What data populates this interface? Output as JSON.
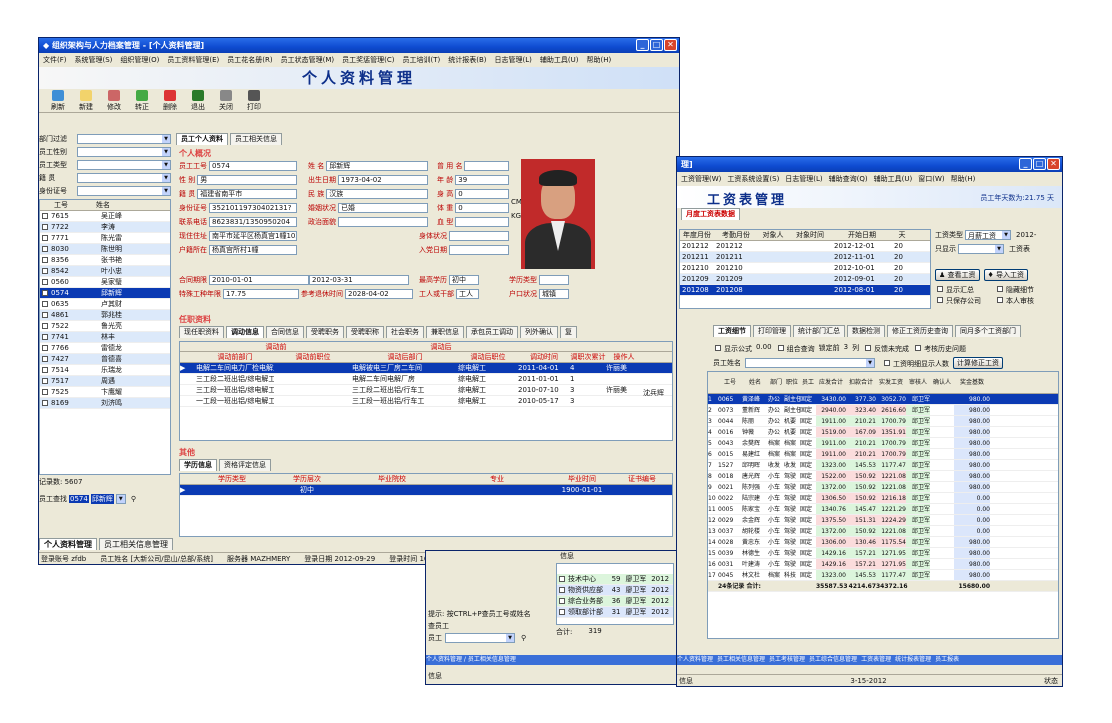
{
  "w1": {
    "title": "组织架构与人力档案管理 - [个人资料管理]",
    "menu": [
      "文件(F)",
      "系统管理(S)",
      "组织管理(O)",
      "员工资料管理(E)",
      "员工花名册(R)",
      "员工状态管理(M)",
      "员工奖惩管理(C)",
      "员工培训(T)",
      "统计报表(B)",
      "日志管理(L)",
      "辅助工具(U)",
      "帮助(H)"
    ],
    "heading": "个人资料管理",
    "toolbar": [
      "刷新",
      "新建",
      "修改",
      "转正",
      "删除",
      "退出",
      "关闭",
      "打印"
    ],
    "filters": [
      "部门过滤",
      "员工性别",
      "员工类型",
      "籍 贯",
      "身份证号"
    ],
    "list_headers": [
      "工号",
      "姓名"
    ],
    "employees": [
      [
        "7615",
        "吴正峰"
      ],
      [
        "7722",
        "李涛"
      ],
      [
        "7771",
        "陈光雷"
      ],
      [
        "8030",
        "陈世明"
      ],
      [
        "8356",
        "张书艳"
      ],
      [
        "8542",
        "叶小忠"
      ],
      [
        "0560",
        "吴家璧"
      ],
      [
        "0574",
        "邱新辉"
      ],
      [
        "0635",
        "卢其财"
      ],
      [
        "4861",
        "郭兆桂"
      ],
      [
        "7522",
        "鲁光亮"
      ],
      [
        "7741",
        "林丰"
      ],
      [
        "7766",
        "雷德龙"
      ],
      [
        "7427",
        "曾德喜"
      ],
      [
        "7514",
        "乐瑞龙"
      ],
      [
        "7517",
        "周遇"
      ],
      [
        "7525",
        "卞鹰耀"
      ],
      [
        "8169",
        "刘济鸣"
      ]
    ],
    "record_count": "记录数: 5607",
    "search_label": "员工查找",
    "search_value": "0574",
    "search_name": "邱新辉",
    "tabs": [
      "员工个人资料",
      "员工相关信息"
    ],
    "section_personal": "个人概况",
    "fields": {
      "empid": [
        "员工工号",
        "0574"
      ],
      "name": [
        "姓  名",
        "邱新辉"
      ],
      "formername": [
        "曾 用 名",
        ""
      ],
      "gender": [
        "性  别",
        "男"
      ],
      "birth": [
        "出生日期",
        "1973-04-02"
      ],
      "age": [
        "年  龄",
        "39"
      ],
      "origin": [
        "籍  贯",
        "福建省南平市"
      ],
      "nation": [
        "民  族",
        "汉族"
      ],
      "height": [
        "身  高",
        "0"
      ],
      "idno": [
        "身份证号",
        "35210119730402131?"
      ],
      "marital": [
        "婚姻状况",
        "已婚"
      ],
      "weight": [
        "体  重",
        "0"
      ],
      "phone": [
        "联系电话",
        "8623831/1350950204"
      ],
      "political": [
        "政治面貌",
        ""
      ],
      "blood": [
        "血  型",
        ""
      ],
      "address": [
        "现住住址",
        "南平市延平区杨真宫1幢102室"
      ],
      "health": [
        "身体状况",
        ""
      ],
      "hukou": [
        "户籍所在",
        "杨真宫所村1幢"
      ],
      "joindate": [
        "入党日期",
        ""
      ],
      "contract": [
        "合同期限",
        "2010-01-01",
        "2012-03-31"
      ],
      "edu": [
        "最高学历",
        "初中"
      ],
      "degree": [
        "学历类型",
        ""
      ],
      "special": [
        "特殊工种年限",
        "17.75"
      ],
      "retire": [
        "参考退休时间",
        "2028-04-02"
      ],
      "worktype": [
        "工人或干部",
        "工人"
      ],
      "hkstatus": [
        "户口状况",
        "城镇"
      ]
    },
    "units": [
      "CM",
      "KG"
    ],
    "section_job": "任职资料",
    "job_tabs": [
      "现任职资料",
      "调动信息",
      "合同信息",
      "受聘职务",
      "受聘职称",
      "社会职务",
      "兼职信息",
      "承包员工调动",
      "列外确认",
      "复"
    ],
    "transfer_headers": [
      "调动前部门",
      "调动前职位",
      "调动后部门",
      "调动后职位",
      "调动时间",
      "调职次累计月份",
      "操作人"
    ],
    "transfer_group": [
      "调动前",
      "调动后"
    ],
    "transfers": [
      [
        "电解二车间电力厂检电解工",
        "",
        "电解被电三厂房二车间",
        "综电解工",
        "2011-04-01",
        "4",
        "许丽美"
      ],
      [
        "三工段二班出铝/综电解工",
        "",
        "电解二车间电解厂房",
        "综电解工",
        "2011-01-01",
        "1",
        ""
      ],
      [
        "三工段一班出铝/综电解工",
        "",
        "三工段二班出铝/行车工",
        "综电解工",
        "2010-07-10",
        "3",
        "许丽美"
      ],
      [
        "一工段一班出铝/综电解工",
        "",
        "三工段一班出铝/行车工",
        "综电解工",
        "2010-05-17",
        "3",
        ""
      ]
    ],
    "transfer_note": "沈兵辉",
    "section_other": "其他",
    "other_tabs": [
      "学历信息",
      "资格评定信息"
    ],
    "edu_headers": [
      "学历类型",
      "学历层次",
      "毕业院校",
      "专业",
      "毕业时间",
      "证书编号"
    ],
    "edu_rows": [
      [
        "",
        "初中",
        "",
        "",
        "1900-01-01",
        ""
      ]
    ],
    "bottom_tabs": [
      "个人资料管理",
      "员工相关信息管理"
    ],
    "status": [
      "登录账号 zfdb",
      "员工姓名 [大新公司/昆山/总部/系统]",
      "服务器 MAZHMERY",
      "登录日期 2012-09-29",
      "登录时间 16:12:29",
      "现在时间 17:38:37"
    ]
  },
  "w2": {
    "title": "理]",
    "menu": [
      "工资管理(W)",
      "工资系统设置(S)",
      "日志管理(L)",
      "辅助查询(Q)",
      "辅助工具(U)",
      "窗口(W)",
      "帮助(H)"
    ],
    "heading": "工资表管理",
    "emp_count": "员工年天数为:21.75 天",
    "sub_tab": "月度工资表数据",
    "period_headers": [
      "年度月份",
      "考勤月份",
      "对象人",
      "对象时间",
      "开始日期",
      "天"
    ],
    "periods": [
      [
        "201212",
        "201212",
        "",
        "",
        "2012-12-01",
        "20"
      ],
      [
        "201211",
        "201211",
        "",
        "",
        "2012-11-01",
        "20"
      ],
      [
        "201210",
        "201210",
        "",
        "",
        "2012-10-01",
        "20"
      ],
      [
        "201209",
        "201209",
        "",
        "",
        "2012-09-01",
        "20"
      ],
      [
        "201208",
        "201208",
        "",
        "",
        "2012-08-01",
        "20"
      ]
    ],
    "right_form": {
      "type_label": "工资类型",
      "type_val": "月薪工资",
      "year_val": "2012-",
      "dept_label": "只显示",
      "query_label": "工资表"
    },
    "buttons": [
      "查看工资",
      "导入工资"
    ],
    "checks": [
      "显示汇总",
      "隐藏细节",
      "只保存公司",
      "本人审核"
    ],
    "tabs": [
      "工资细节",
      "打印管理",
      "统计部门汇总",
      "数据检测",
      "修正工资历史查询",
      "同月多个工资部门"
    ],
    "opts": [
      "显示公式",
      "组合查询",
      "锁定前",
      "列",
      "反馈未完成",
      "考核历史问题"
    ],
    "opts_vals": {
      "zoom": "0.00",
      "lock": "3"
    },
    "filter": {
      "label": "员工姓名",
      "c1": "工资明细显示人数",
      "c2": "计算修正工资"
    },
    "grid_headers": [
      "工号",
      "姓名",
      "部门",
      "职位",
      "员工类型",
      "应发合计",
      "扣款合计",
      "实发工资",
      "审核人",
      "确认人",
      "奖金基数"
    ],
    "grid": [
      [
        "0065",
        "黄泽峰",
        "办公",
        "副主任",
        "固定",
        "3430.00",
        "377.30",
        "3052.70",
        "邱卫军",
        "",
        "980.00"
      ],
      [
        "0073",
        "董新辉",
        "办公",
        "副主任",
        "固定",
        "2940.00",
        "323.40",
        "2616.60",
        "邱卫军",
        "",
        "980.00"
      ],
      [
        "0044",
        "陈丽",
        "办公",
        "机要",
        "固定",
        "1911.00",
        "210.21",
        "1700.79",
        "邱卫军",
        "",
        "980.00"
      ],
      [
        "0016",
        "钟薇",
        "办公",
        "机要",
        "固定",
        "1519.00",
        "167.09",
        "1351.91",
        "邱卫军",
        "",
        "980.00"
      ],
      [
        "0043",
        "余樊辉",
        "档案",
        "档案",
        "固定",
        "1911.00",
        "210.21",
        "1700.79",
        "邱卫军",
        "",
        "980.00"
      ],
      [
        "0015",
        "易建红",
        "档案",
        "档案",
        "固定",
        "1911.00",
        "210.21",
        "1700.79",
        "邱卫军",
        "",
        "980.00"
      ],
      [
        "1527",
        "邱明晖",
        "收发",
        "收发",
        "固定",
        "1323.00",
        "145.53",
        "1177.47",
        "邱卫军",
        "",
        "980.00"
      ],
      [
        "0018",
        "唐光辉",
        "小车",
        "驾驶",
        "固定",
        "1522.00",
        "150.92",
        "1221.08",
        "邱卫军",
        "",
        "980.00"
      ],
      [
        "0021",
        "陈列强",
        "小车",
        "驾驶",
        "固定",
        "1372.00",
        "150.92",
        "1221.08",
        "邱卫军",
        "",
        "980.00"
      ],
      [
        "0022",
        "陆宗建",
        "小车",
        "驾驶",
        "固定",
        "1306.50",
        "150.92",
        "1216.18",
        "邱卫军",
        "",
        "0.00"
      ],
      [
        "0005",
        "陈家宝",
        "小车",
        "驾驶",
        "固定",
        "1340.76",
        "145.47",
        "1221.29",
        "邱卫军",
        "",
        "0.00"
      ],
      [
        "0029",
        "余金辉",
        "小车",
        "驾驶",
        "固定",
        "1375.50",
        "151.31",
        "1224.29",
        "邱卫军",
        "",
        "0.00"
      ],
      [
        "0037",
        "胡轮楼",
        "小车",
        "驾驶",
        "固定",
        "1372.00",
        "150.92",
        "1221.08",
        "邱卫军",
        "",
        "0.00"
      ],
      [
        "0028",
        "黄忠东",
        "小车",
        "驾驶",
        "固定",
        "1306.00",
        "130.46",
        "1175.54",
        "邱卫军",
        "",
        "980.00"
      ],
      [
        "0039",
        "林德生",
        "小车",
        "驾驶",
        "固定",
        "1429.16",
        "157.21",
        "1271.95",
        "邱卫军",
        "",
        "980.00"
      ],
      [
        "0031",
        "叶建涛",
        "小车",
        "驾驶",
        "固定",
        "1429.16",
        "157.21",
        "1271.95",
        "邱卫军",
        "",
        "980.00"
      ],
      [
        "0045",
        "林文杜",
        "档案",
        "科技",
        "固定",
        "1323.00",
        "145.53",
        "1177.47",
        "邱卫军",
        "",
        "980.00"
      ]
    ],
    "total": [
      "24条记录 合计:",
      "",
      "",
      "",
      "",
      "35587.53",
      "4214.67",
      "34372.16",
      "",
      "",
      "15680.00"
    ],
    "bottom_tabs": [
      "个人资料管理",
      "员工相关信息管理",
      "员工考核管理",
      "员工综合信息管理",
      "工资表管理",
      "统计报表管理",
      "员工报表"
    ],
    "status": [
      "信息",
      "3-15-2012",
      "状态"
    ]
  },
  "w3": {
    "header": "信息",
    "rows": [
      [
        "技术中心",
        "59",
        "廖卫军",
        "2012"
      ],
      [
        "物资供应部",
        "43",
        "廖卫军",
        "2012"
      ],
      [
        "综合业务部",
        "36",
        "廖卫军",
        "2012"
      ],
      [
        "领取部计部",
        "31",
        "廖卫军",
        "2012"
      ]
    ],
    "total": [
      "合计:",
      "319"
    ],
    "hint": "提示: 按CTRL+P查员工号或姓名",
    "label": "查员工",
    "field": "员工"
  }
}
